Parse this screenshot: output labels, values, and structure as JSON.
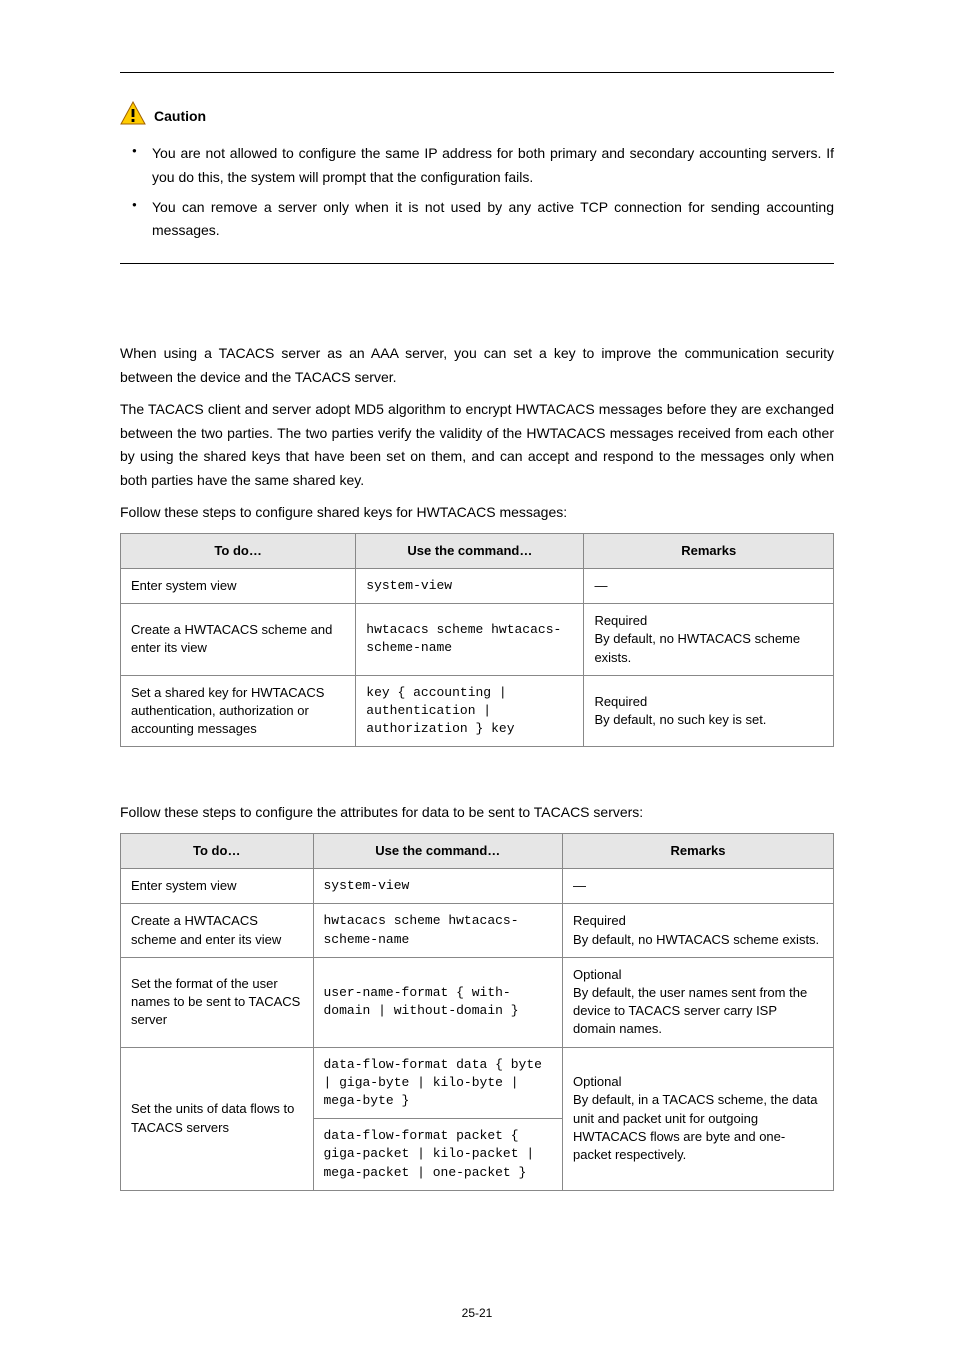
{
  "caution": {
    "label": "Caution",
    "items": [
      "You are not allowed to configure the same IP address for both primary and secondary accounting servers. If you do this, the system will prompt that the configuration fails.",
      "You can remove a server only when it is not used by any active TCP connection for sending accounting messages."
    ]
  },
  "section1": {
    "p1": "When using a TACACS server as an AAA server, you can set a key to improve the communication security between the device and the TACACS server.",
    "p2": "The TACACS client and server adopt MD5 algorithm to encrypt HWTACACS messages before they are exchanged between the two parties. The two parties verify the validity of the HWTACACS messages received from each other by using the shared keys that have been set on them, and can accept and respond to the messages only when both parties have the same shared key.",
    "lead": "Follow these steps to configure shared keys for HWTACACS messages:"
  },
  "table1": {
    "headers": [
      "To do…",
      "Use the command…",
      "Remarks"
    ],
    "rows": [
      {
        "c0": "Enter system view",
        "c1": "system-view",
        "c2": "—"
      },
      {
        "c0": "Create a HWTACACS scheme and enter its view",
        "c1": "hwtacacs scheme hwtacacs-scheme-name",
        "c2": "Required\nBy default, no HWTACACS scheme exists."
      },
      {
        "c0": "Set a shared key for HWTACACS authentication, authorization or accounting messages",
        "c1": "key { accounting | authentication | authorization } key",
        "c2": "Required\nBy default, no such key is set."
      }
    ]
  },
  "section2": {
    "lead": "Follow these steps to configure the attributes for data to be sent to TACACS servers:"
  },
  "table2": {
    "headers": [
      "To do…",
      "Use the command…",
      "Remarks"
    ],
    "rows": [
      {
        "c0": "Enter system view",
        "c1": "system-view",
        "c2": "—"
      },
      {
        "c0": "Create a HWTACACS scheme and enter its view",
        "c1": "hwtacacs scheme hwtacacs-scheme-name",
        "c2": "Required\nBy default, no HWTACACS scheme exists."
      },
      {
        "c0": "Set the format of the user names to be sent to TACACS server",
        "c1": "user-name-format { with-domain | without-domain }",
        "c2": "Optional\nBy default, the user names sent from the device to TACACS server carry ISP domain names."
      }
    ],
    "row4": {
      "c0": "Set the units of data flows to TACACS servers",
      "c1a": "data-flow-format data { byte | giga-byte | kilo-byte | mega-byte }",
      "c1b": "data-flow-format packet { giga-packet | kilo-packet | mega-packet | one-packet }",
      "c2": "Optional\nBy default, in a TACACS scheme, the data unit and packet unit for outgoing HWTACACS flows are byte and one-packet respectively."
    }
  },
  "pageNumber": "25-21"
}
